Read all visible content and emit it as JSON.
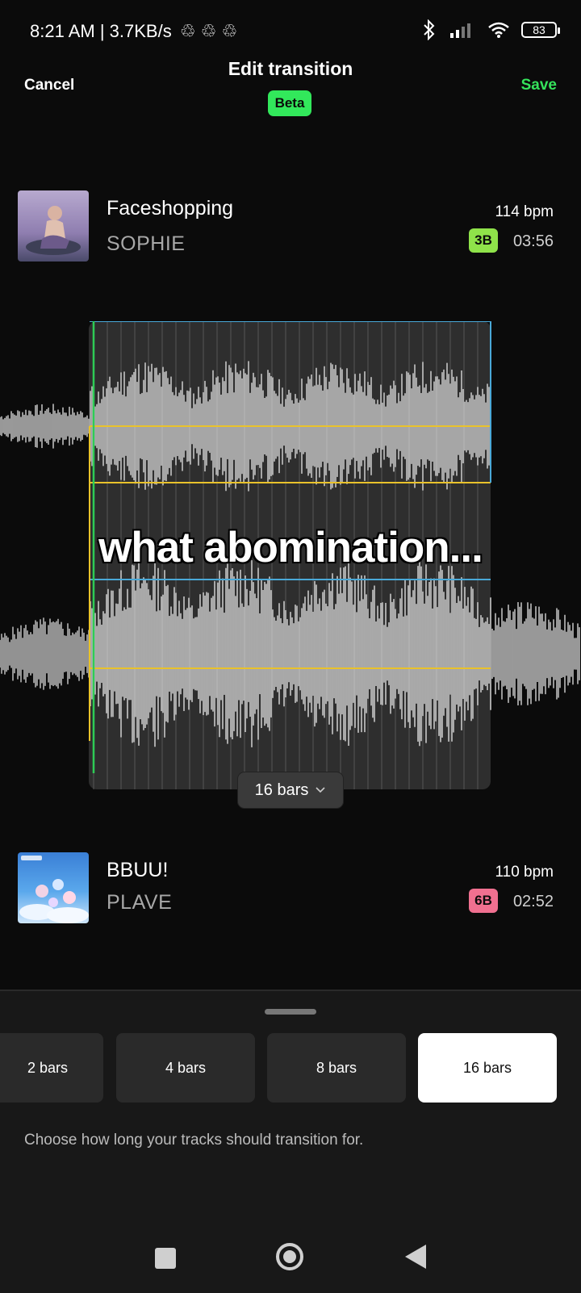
{
  "status_bar": {
    "time_speed": "8:21 AM | 3.7KB/s",
    "battery": "83"
  },
  "header": {
    "cancel_label": "Cancel",
    "title": "Edit transition",
    "badge": "Beta",
    "save_label": "Save"
  },
  "track_a": {
    "title": "Faceshopping",
    "artist": "SOPHIE",
    "bpm": "114 bpm",
    "key": "3B",
    "key_color": "#8fe34a",
    "duration": "03:56"
  },
  "track_b": {
    "title": "BBUU!",
    "artist": "PLAVE",
    "bpm": "110 bpm",
    "key": "6B",
    "key_color": "#f07090",
    "duration": "02:52"
  },
  "waveform": {
    "length_label": "16 bars"
  },
  "overlay_caption": "what abomination...",
  "sheet": {
    "options": [
      "2 bars",
      "4 bars",
      "8 bars",
      "16 bars"
    ],
    "selected": "16 bars",
    "hint": "Choose how long your tracks should transition for."
  },
  "colors": {
    "accent": "#35e35b",
    "marker_yellow": "#e9c22b",
    "marker_blue": "#4aa9d8",
    "marker_green": "#2ecc55"
  },
  "icons": [
    "sync-icon",
    "bluetooth-icon",
    "signal-icon",
    "wifi-icon",
    "battery-icon",
    "chevron-down-icon",
    "nav-recents-icon",
    "nav-home-icon",
    "nav-back-icon"
  ]
}
